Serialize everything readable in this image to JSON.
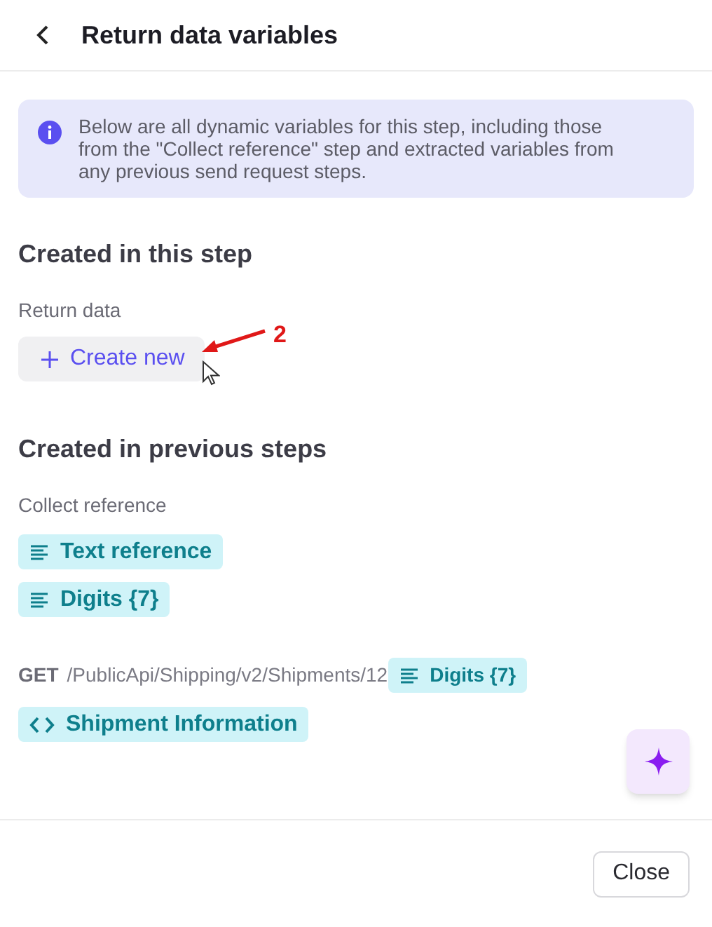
{
  "header": {
    "title": "Return data variables"
  },
  "info": "Below are all dynamic variables for this step, including those from the \"Collect reference\" step and extracted variables from any previous send request steps.",
  "this_step": {
    "heading": "Created in this step",
    "group": "Return data",
    "button": "Create new",
    "annotation": "2"
  },
  "previous_steps": {
    "heading": "Created in previous steps",
    "groups": [
      {
        "label": "Collect reference",
        "variables": [
          {
            "kind": "text",
            "label": "Text reference"
          },
          {
            "kind": "text",
            "label": "Digits {7}"
          }
        ]
      },
      {
        "method": "GET",
        "path": "/PublicApi/Shipping/v2/Shipments/12",
        "inline_variable": {
          "kind": "text",
          "label": "Digits {7}"
        },
        "variables": [
          {
            "kind": "code",
            "label": "Shipment Information"
          }
        ]
      }
    ]
  },
  "footer": {
    "button": "Close"
  }
}
